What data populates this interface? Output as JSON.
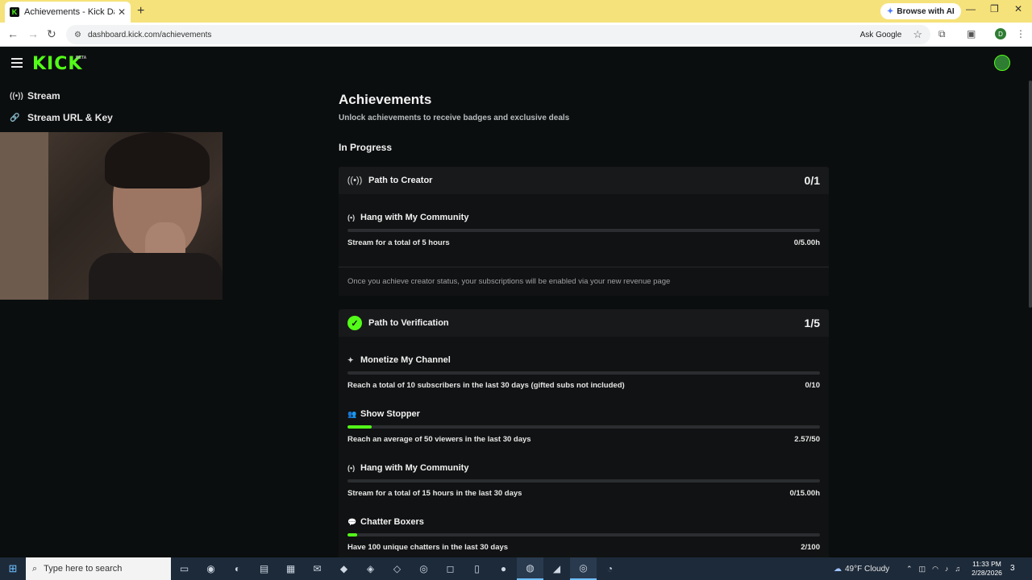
{
  "browser": {
    "tab_title": "Achievements - Kick Dashboard",
    "favicon_letter": "K",
    "url": "dashboard.kick.com/achievements",
    "browse_with_ai": "Browse with AI",
    "ask_google": "Ask Google",
    "profile_initial": "D"
  },
  "nav": {
    "logo": "KICK",
    "logo_badge": "BETA"
  },
  "sidebar": {
    "items": [
      {
        "label": "Stream",
        "icon": "broadcast-icon"
      },
      {
        "label": "Stream URL & Key",
        "icon": "link-icon"
      }
    ]
  },
  "main": {
    "title": "Achievements",
    "subtitle": "Unlock achievements to receive badges and exclusive deals",
    "section_title": "In Progress",
    "cards": [
      {
        "title": "Path to Creator",
        "count": "0/1",
        "icon": "broadcast-icon",
        "tasks": [
          {
            "title": "Hang with My Community",
            "icon": "broadcast-icon",
            "description": "Stream for a total of 5 hours",
            "progress": "0/5.00h",
            "fraction": 0
          }
        ],
        "note": "Once you achieve creator status, your subscriptions will be enabled via your new revenue page"
      },
      {
        "title": "Path to Verification",
        "count": "1/5",
        "icon": "verified-icon",
        "tasks": [
          {
            "title": "Monetize My Channel",
            "icon": "sparkle-icon",
            "description": "Reach a total of 10 subscribers in the last 30 days (gifted subs not included)",
            "progress": "0/10",
            "fraction": 0
          },
          {
            "title": "Show Stopper",
            "icon": "viewers-icon",
            "description": "Reach an average of 50 viewers in the last 30 days",
            "progress": "2.57/50",
            "fraction": 0.0514
          },
          {
            "title": "Hang with My Community",
            "icon": "broadcast-icon",
            "description": "Stream for a total of 15 hours in the last 30 days",
            "progress": "0/15.00h",
            "fraction": 0
          },
          {
            "title": "Chatter Boxers",
            "icon": "chat-icon",
            "description": "Have 100 unique chatters in the last 30 days",
            "progress": "2/100",
            "fraction": 0.02
          }
        ]
      }
    ]
  },
  "taskbar": {
    "search_placeholder": "Type here to search",
    "weather": "49°F  Cloudy",
    "time": "11:33 PM",
    "date": "2/28/2026",
    "notification_count": "3"
  },
  "colors": {
    "accent": "#53fc18",
    "background": "#0b0e0f",
    "card": "#18191b",
    "titlebar": "#f6e27a"
  }
}
